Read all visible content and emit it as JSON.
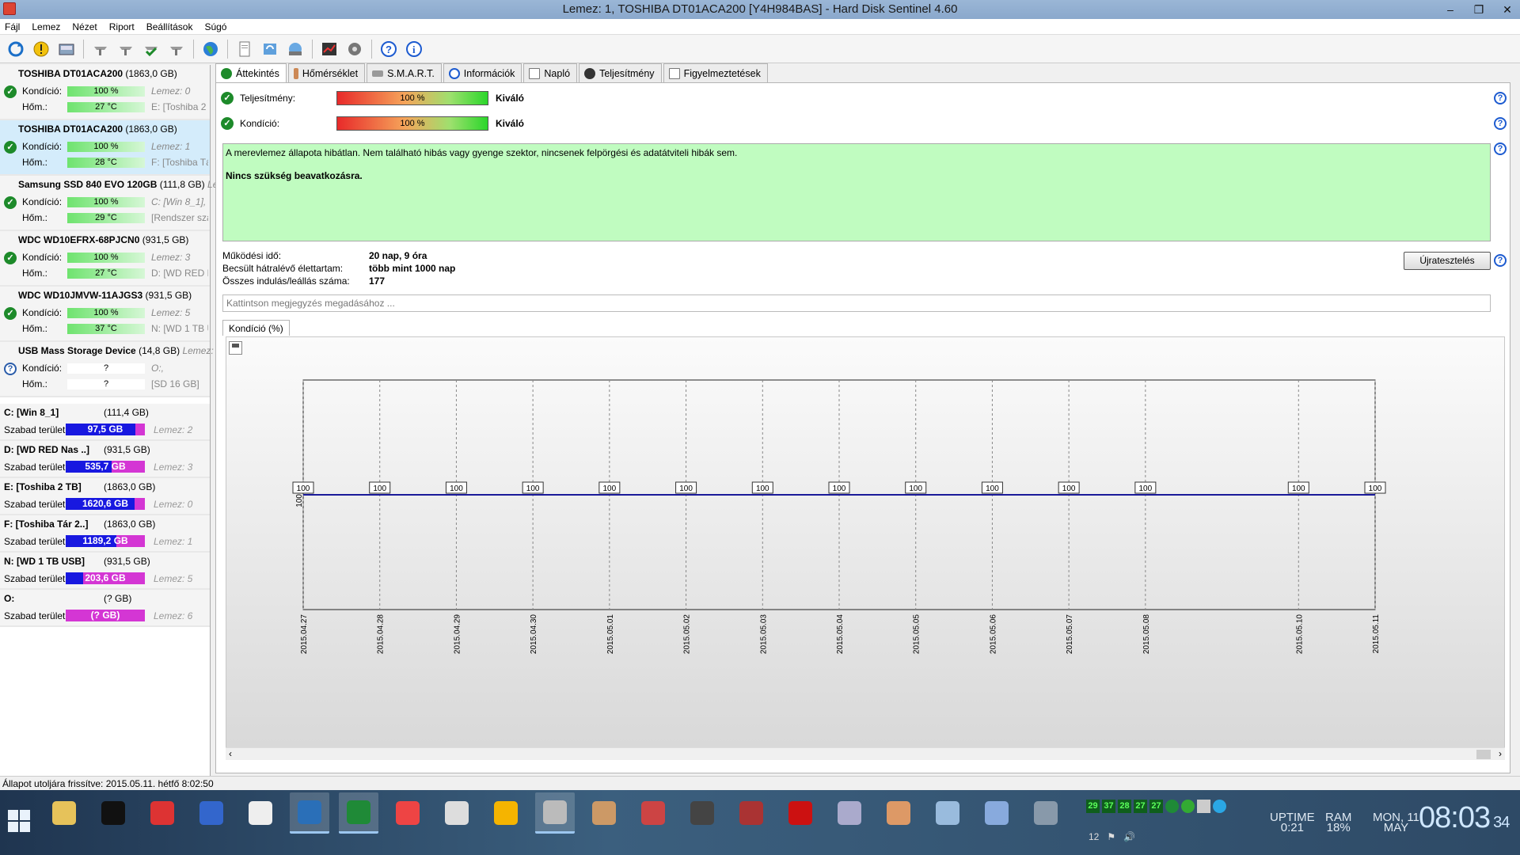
{
  "window": {
    "title": "Lemez: 1, TOSHIBA DT01ACA200 [Y4H984BAS]  -  Hard Disk Sentinel 4.60",
    "buttons": [
      "–",
      "❐",
      "✕"
    ]
  },
  "menu": [
    "Fájl",
    "Lemez",
    "Nézet",
    "Riport",
    "Beállítások",
    "Súgó"
  ],
  "toolbar_icons": [
    "refresh-icon",
    "alert-icon",
    "disk-icon",
    "wrench-icon",
    "wrench-icon",
    "wrench-check-icon",
    "wrench-icon",
    "globe-icon",
    "report-icon",
    "sync-icon",
    "network-icon",
    "chart-icon",
    "gear-disk-icon",
    "help-icon",
    "info-icon"
  ],
  "disks": [
    {
      "name": "TOSHIBA DT01ACA200",
      "size": "(1863,0 GB)",
      "cond_label": "Kondíció:",
      "cond": "100 %",
      "cond_note": "Lemez: 0",
      "temp_label": "Hőm.:",
      "temp": "27 °C",
      "temp_note": "E: [Toshiba 2",
      "status": "ok"
    },
    {
      "name": "TOSHIBA DT01ACA200",
      "size": "(1863,0 GB)",
      "cond_label": "Kondíció:",
      "cond": "100 %",
      "cond_note": "Lemez: 1",
      "temp_label": "Hőm.:",
      "temp": "28 °C",
      "temp_note": "F: [Toshiba Tá",
      "status": "ok"
    },
    {
      "name": "Samsung SSD 840 EVO 120GB",
      "size": "(111,8 GB)",
      "size_note": "Le",
      "cond_label": "Kondíció:",
      "cond": "100 %",
      "cond_note": "C: [Win 8_1],",
      "temp_label": "Hőm.:",
      "temp": "29 °C",
      "temp_note": "[Rendszer szá",
      "status": "ok"
    },
    {
      "name": "WDC WD10EFRX-68PJCN0",
      "size": "(931,5 GB)",
      "cond_label": "Kondíció:",
      "cond": "100 %",
      "cond_note": "Lemez: 3",
      "temp_label": "Hőm.:",
      "temp": "27 °C",
      "temp_note": "D: [WD RED N",
      "status": "ok"
    },
    {
      "name": "WDC WD10JMVW-11AJGS3",
      "size": "(931,5 GB)",
      "cond_label": "Kondíció:",
      "cond": "100 %",
      "cond_note": "Lemez: 5",
      "temp_label": "Hőm.:",
      "temp": "37 °C",
      "temp_note": "N: [WD 1 TB U",
      "status": "ok"
    },
    {
      "name": "USB Mass Storage Device",
      "size": "(14,8 GB)",
      "size_note": "Lemez:",
      "cond_label": "Kondíció:",
      "cond": "?",
      "cond_note": "O:,",
      "temp_label": "Hőm.:",
      "temp": "?",
      "temp_note": "[SD 16 GB]",
      "status": "unknown"
    }
  ],
  "volumes": [
    {
      "name": "C: [Win 8_1]",
      "size": "(111,4 GB)",
      "free_label": "Szabad terület",
      "free": "97,5 GB",
      "free_pct": 12,
      "disk": "Lemez: 2"
    },
    {
      "name": "D: [WD RED Nas ..]",
      "size": "(931,5 GB)",
      "free_label": "Szabad terület",
      "free": "535,7 GB",
      "free_pct": 42,
      "disk": "Lemez: 3"
    },
    {
      "name": "E: [Toshiba 2 TB]",
      "size": "(1863,0 GB)",
      "free_label": "Szabad terület",
      "free": "1620,6 GB",
      "free_pct": 13,
      "disk": "Lemez: 0"
    },
    {
      "name": "F: [Toshiba Tár 2..]",
      "size": "(1863,0 GB)",
      "free_label": "Szabad terület",
      "free": "1189,2 GB",
      "free_pct": 36,
      "disk": "Lemez: 1"
    },
    {
      "name": "N: [WD 1 TB USB]",
      "size": "(931,5 GB)",
      "free_label": "Szabad terület",
      "free": "203,6 GB",
      "free_pct": 78,
      "disk": "Lemez: 5"
    },
    {
      "name": "O:",
      "size": "(? GB)",
      "free_label": "Szabad terület",
      "free": "(? GB)",
      "free_pct": 100,
      "disk": "Lemez: 6"
    }
  ],
  "tabs": [
    "Áttekintés",
    "Hőmérséklet",
    "S.M.A.R.T.",
    "Információk",
    "Napló",
    "Teljesítmény",
    "Figyelmeztetések"
  ],
  "overview": {
    "performance": {
      "label": "Teljesítmény:",
      "value": "100 %",
      "rating": "Kiváló"
    },
    "condition": {
      "label": "Kondíció:",
      "value": "100 %",
      "rating": "Kiváló"
    },
    "status_text": "A merevlemez állapota hibátlan. Nem található hibás vagy gyenge szektor, nincsenek felpörgési és adatátviteli hibák sem.",
    "action_text": "Nincs szükség beavatkozásra.",
    "info": [
      {
        "k": "Működési idő:",
        "v": "20 nap, 9 óra"
      },
      {
        "k": "Becsült hátralévő élettartam:",
        "v": "több mint 1000 nap"
      },
      {
        "k": "Összes indulás/leállás száma:",
        "v": "177"
      }
    ],
    "retest_label": "Újratesztelés",
    "note_placeholder": "Kattintson megjegyzés megadásához ...",
    "chart_tab": "Kondíció  (%)"
  },
  "chart_data": {
    "type": "line",
    "categories": [
      "2015.04.27",
      "2015.04.28",
      "2015.04.29",
      "2015.04.30",
      "2015.05.01",
      "2015.05.02",
      "2015.05.03",
      "2015.05.04",
      "2015.05.05",
      "2015.05.06",
      "2015.05.07",
      "2015.05.08",
      "2015.05.10",
      "2015.05.11"
    ],
    "x_positions": [
      0,
      1,
      2,
      3,
      4,
      5,
      6,
      7,
      8,
      9,
      10,
      11,
      13,
      14
    ],
    "values": [
      100,
      100,
      100,
      100,
      100,
      100,
      100,
      100,
      100,
      100,
      100,
      100,
      100,
      100
    ],
    "y_tick": "100",
    "ylim": [
      0,
      200
    ],
    "grid": true,
    "line_color": "#1a1a9a"
  },
  "status_line": "Állapot utoljára frissítve: 2015.05.11. hétfő 8:02:50",
  "taskbar": {
    "apps": [
      "folder",
      "cmd",
      "hdd-red",
      "floppy",
      "file",
      "globe-blue",
      "utorrent",
      "ccleaner",
      "calendar",
      "warning",
      "hds",
      "disc",
      "cpu-z",
      "chip",
      "winrar",
      "aida64",
      "tools",
      "users",
      "monitor",
      "settings",
      "wrench"
    ],
    "tray_temps": [
      "29",
      "37",
      "28",
      "27",
      "27"
    ],
    "tray_icons": [
      "12",
      "⚑",
      "🔊"
    ],
    "uptime_label": "UPTIME",
    "uptime": "0:21",
    "ram_label": "RAM",
    "ram": "18%",
    "day": "MON, 11",
    "month": "MAY",
    "time": "08:03",
    "seconds": "34"
  }
}
